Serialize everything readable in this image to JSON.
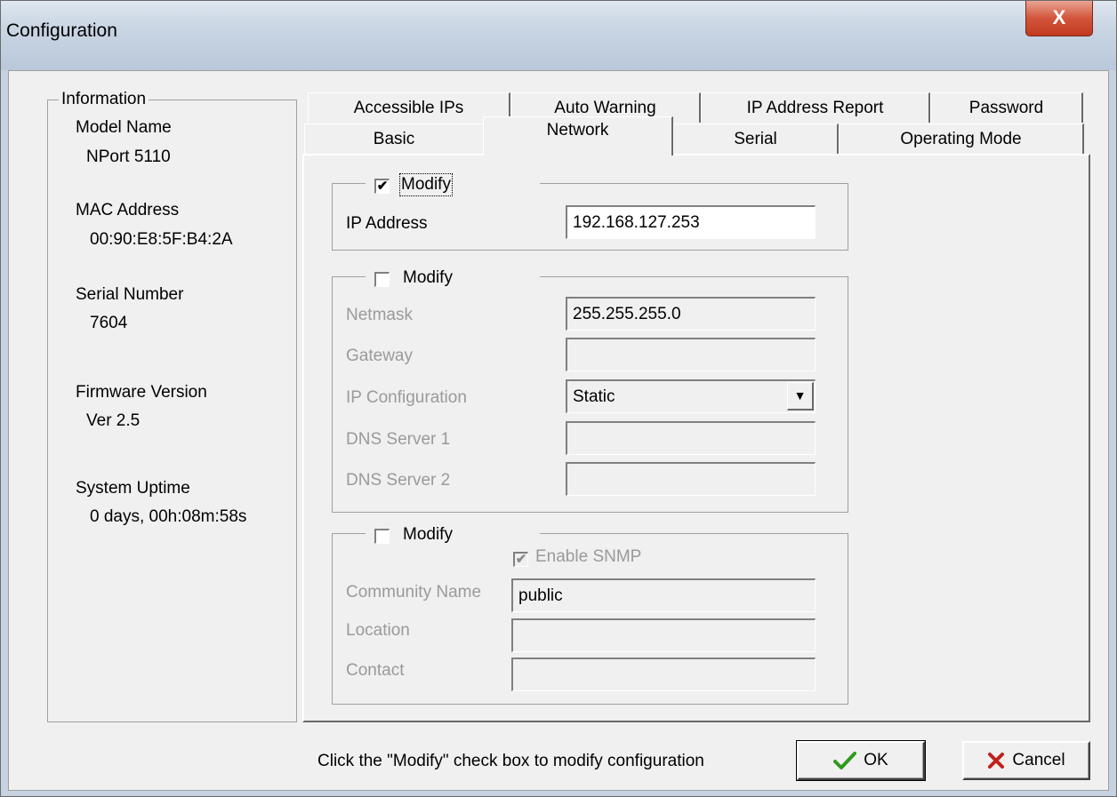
{
  "window": {
    "title": "Configuration",
    "close_label": "X"
  },
  "info": {
    "legend": "Information",
    "items": [
      {
        "label": "Model Name",
        "value": "NPort 5110"
      },
      {
        "label": "MAC Address",
        "value": "00:90:E8:5F:B4:2A"
      },
      {
        "label": "Serial Number",
        "value": "7604"
      },
      {
        "label": "Firmware Version",
        "value": "Ver 2.5"
      },
      {
        "label": "System Uptime",
        "value": "0 days, 00h:08m:58s"
      }
    ]
  },
  "tabs": {
    "back_row": [
      "Accessible IPs",
      "Auto Warning",
      "IP Address Report",
      "Password"
    ],
    "front_row": [
      "Basic",
      "Network",
      "Serial",
      "Operating Mode"
    ],
    "active": "Network"
  },
  "network": {
    "ip_group": {
      "modify_label": "Modify",
      "modify_checked": true,
      "ip_label": "IP Address",
      "ip_value": "192.168.127.253"
    },
    "net_group": {
      "modify_label": "Modify",
      "modify_checked": false,
      "netmask_label": "Netmask",
      "netmask_value": "255.255.255.0",
      "gateway_label": "Gateway",
      "gateway_value": "",
      "ipconfig_label": "IP Configuration",
      "ipconfig_value": "Static",
      "dns1_label": "DNS Server 1",
      "dns1_value": "",
      "dns2_label": "DNS Server 2",
      "dns2_value": ""
    },
    "snmp_group": {
      "modify_label": "Modify",
      "modify_checked": false,
      "enable_snmp_label": "Enable SNMP",
      "enable_snmp_checked": true,
      "community_label": "Community Name",
      "community_value": "public",
      "location_label": "Location",
      "location_value": "",
      "contact_label": "Contact",
      "contact_value": ""
    }
  },
  "footer": {
    "hint": "Click the \"Modify\" check box to modify configuration",
    "ok_label": "OK",
    "cancel_label": "Cancel"
  },
  "colors": {
    "ok_check": "#2e9a1e",
    "cancel_x": "#c0201a"
  }
}
